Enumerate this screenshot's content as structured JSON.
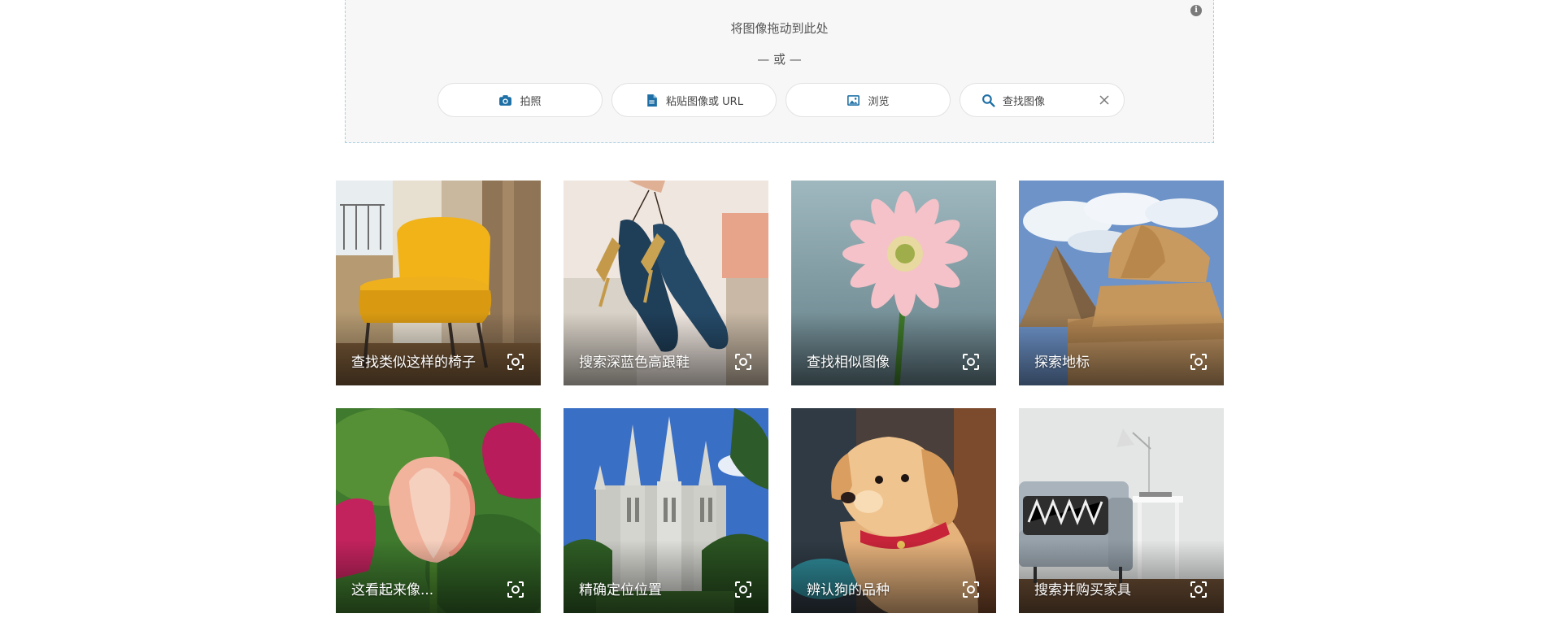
{
  "dropzone": {
    "drag_text": "将图像拖动到此处",
    "or_text": "— 或 —",
    "info_icon": "i",
    "buttons": {
      "camera": {
        "label": "拍照",
        "icon": "camera-icon"
      },
      "paste": {
        "label": "粘贴图像或 URL",
        "icon": "document-icon"
      },
      "browse": {
        "label": "浏览",
        "icon": "image-icon"
      },
      "search": {
        "label": "查找图像",
        "icon": "search-icon"
      }
    }
  },
  "colors": {
    "accent": "#1d6fa5",
    "dropzone_bg": "#f7f7f7",
    "dashed_border": "#a9cde2"
  },
  "tiles": [
    {
      "label": "查找类似这样的椅子",
      "subject": "yellow-chair"
    },
    {
      "label": "搜索深蓝色高跟鞋",
      "subject": "blue-heels"
    },
    {
      "label": "查找相似图像",
      "subject": "pink-gerbera"
    },
    {
      "label": "探索地标",
      "subject": "sphinx-pyramid"
    },
    {
      "label": "这看起来像...",
      "subject": "tulip"
    },
    {
      "label": "精确定位位置",
      "subject": "temple"
    },
    {
      "label": "辨认狗的品种",
      "subject": "puppy"
    },
    {
      "label": "搜索并购买家具",
      "subject": "sofa"
    }
  ]
}
